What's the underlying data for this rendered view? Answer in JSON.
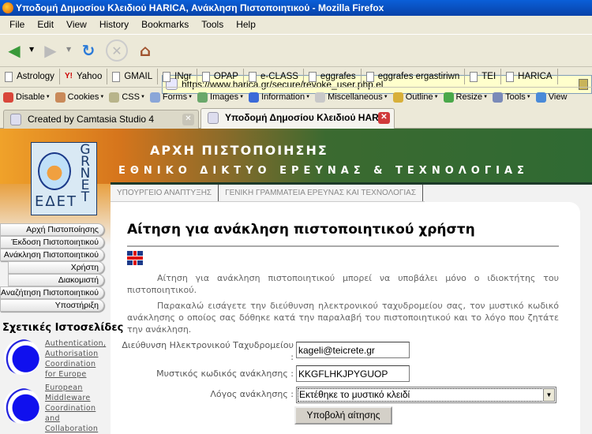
{
  "window": {
    "title": "Υποδομή Δημοσίου Κλειδιού HARICA, Ανάκληση Πιστοποιητικού - Mozilla Firefox"
  },
  "menu": [
    "File",
    "Edit",
    "View",
    "History",
    "Bookmarks",
    "Tools",
    "Help"
  ],
  "url": "https://www.harica.gr/secure/revoke_user.php.el",
  "bookmarks": [
    "Astrology",
    "Yahoo",
    "GMAIL",
    "INgr",
    "OPAP",
    "e-CLASS",
    "eggrafes",
    "eggrafes ergastiriwn",
    "TEI",
    "HARICA"
  ],
  "devtoolbar": [
    {
      "label": "Disable",
      "icon": "disable-icon",
      "color": "#d9463a"
    },
    {
      "label": "Cookies",
      "icon": "cookies-icon",
      "color": "#c98a5a"
    },
    {
      "label": "CSS",
      "icon": "css-icon",
      "color": "#b8b48a"
    },
    {
      "label": "Forms",
      "icon": "forms-icon",
      "color": "#8aa6d8"
    },
    {
      "label": "Images",
      "icon": "images-icon",
      "color": "#6aa86a"
    },
    {
      "label": "Information",
      "icon": "information-icon",
      "color": "#3a6ad8"
    },
    {
      "label": "Miscellaneous",
      "icon": "miscellaneous-icon",
      "color": "#c8c8c8"
    },
    {
      "label": "Outline",
      "icon": "outline-icon",
      "color": "#d8b03a"
    },
    {
      "label": "Resize",
      "icon": "resize-icon",
      "color": "#4aa84a"
    },
    {
      "label": "Tools",
      "icon": "tools-icon",
      "color": "#7a8ab8"
    },
    {
      "label": "View",
      "icon": "view-icon",
      "color": "#4a8ad8"
    }
  ],
  "tabs": [
    {
      "label": "Created by Camtasia Studio 4",
      "active": false
    },
    {
      "label": "Υποδομή Δημοσίου Κλειδιού HARI...",
      "active": true
    }
  ],
  "banner": {
    "line1": "ΑΡΧΗ ΠΙΣΤΟΠΟΙΗΣΗΣ",
    "line2": "ΕΘΝΙΚΟ ΔΙΚΤΥΟ ΕΡΕΥΝΑΣ & ΤΕΧΝΟΛΟΓΙΑΣ",
    "logo_text": "ΕΔΕΤ GRNET"
  },
  "subnav": [
    "ΥΠΟΥΡΓΕΙΟ ΑΝΑΠΤΥΞΗΣ",
    "ΓΕΝΙΚΗ ΓΡΑΜΜΑΤΕΙΑ ΕΡΕΥΝΑΣ ΚΑΙ ΤΕΧΝΟΛΟΓΙΑΣ"
  ],
  "leftmenu": [
    {
      "label": "Αρχή Πιστοποίησης",
      "sub": false
    },
    {
      "label": "Έκδοση Πιστοποιητικού",
      "sub": false
    },
    {
      "label": "Ανάκληση Πιστοποιητικού",
      "sub": false
    },
    {
      "label": "Χρήστη",
      "sub": true
    },
    {
      "label": "Διακομιστή",
      "sub": true
    },
    {
      "label": "Αναζήτηση Πιστοποιητικού",
      "sub": false
    },
    {
      "label": "Υποστήριξη",
      "sub": false
    }
  ],
  "related": {
    "title": "Σχετικές Ιστοσελίδες",
    "links": [
      "Authentication, Authorisation Coordination for Europe",
      "European Middleware Coordination and Collaboration"
    ]
  },
  "main": {
    "heading": "Αίτηση για ανάκληση πιστοποιητικού χρήστη",
    "para1": "Αίτηση για ανάκληση πιστοποιητικού μπορεί να υποβάλει μόνο ο ιδιοκτήτης του πιστοποιητικού.",
    "para2": "Παρακαλώ εισάγετε την διεύθυνση ηλεκτρονικού ταχυδρομείου σας, τον μυστικό κωδικό ανάκλησης ο οποίος σας δόθηκε κατά την παραλαβή του πιστοποιητικού και το λόγο που ζητάτε την ανάκληση.",
    "email_label": "Διεύθυνση Ηλεκτρονικού Ταχυδρομείου :",
    "email_value": "kageli@teicrete.gr",
    "code_label": "Μυστικός κωδικός ανάκλησης :",
    "code_value": "KKGFLHKJPYGUOP",
    "reason_label": "Λόγος ανάκλησης :",
    "reason_value": "Εκτέθηκε το μυστικό κλειδί",
    "submit": "Υποβολή αίτησης"
  }
}
